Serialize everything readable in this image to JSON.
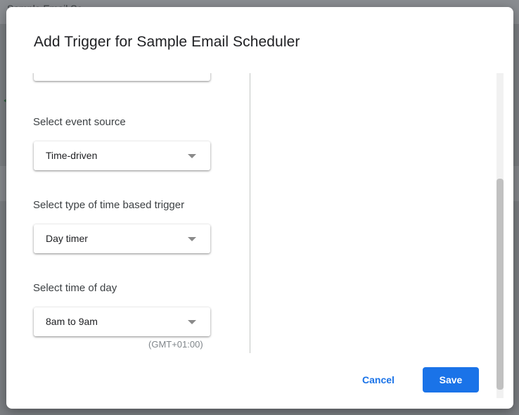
{
  "background": {
    "app_title": "Sample Email Sc..."
  },
  "dialog": {
    "title": "Add Trigger for Sample Email Scheduler",
    "fields": [
      {
        "label": "",
        "value": ""
      },
      {
        "label": "Select event source",
        "value": "Time-driven"
      },
      {
        "label": "Select type of time based trigger",
        "value": "Day timer"
      },
      {
        "label": "Select time of day",
        "value": "8am to 9am"
      }
    ],
    "timezone": "(GMT+01:00)",
    "cancel_label": "Cancel",
    "save_label": "Save"
  },
  "colors": {
    "primary": "#1a73e8",
    "overlay": "#5f6368"
  }
}
